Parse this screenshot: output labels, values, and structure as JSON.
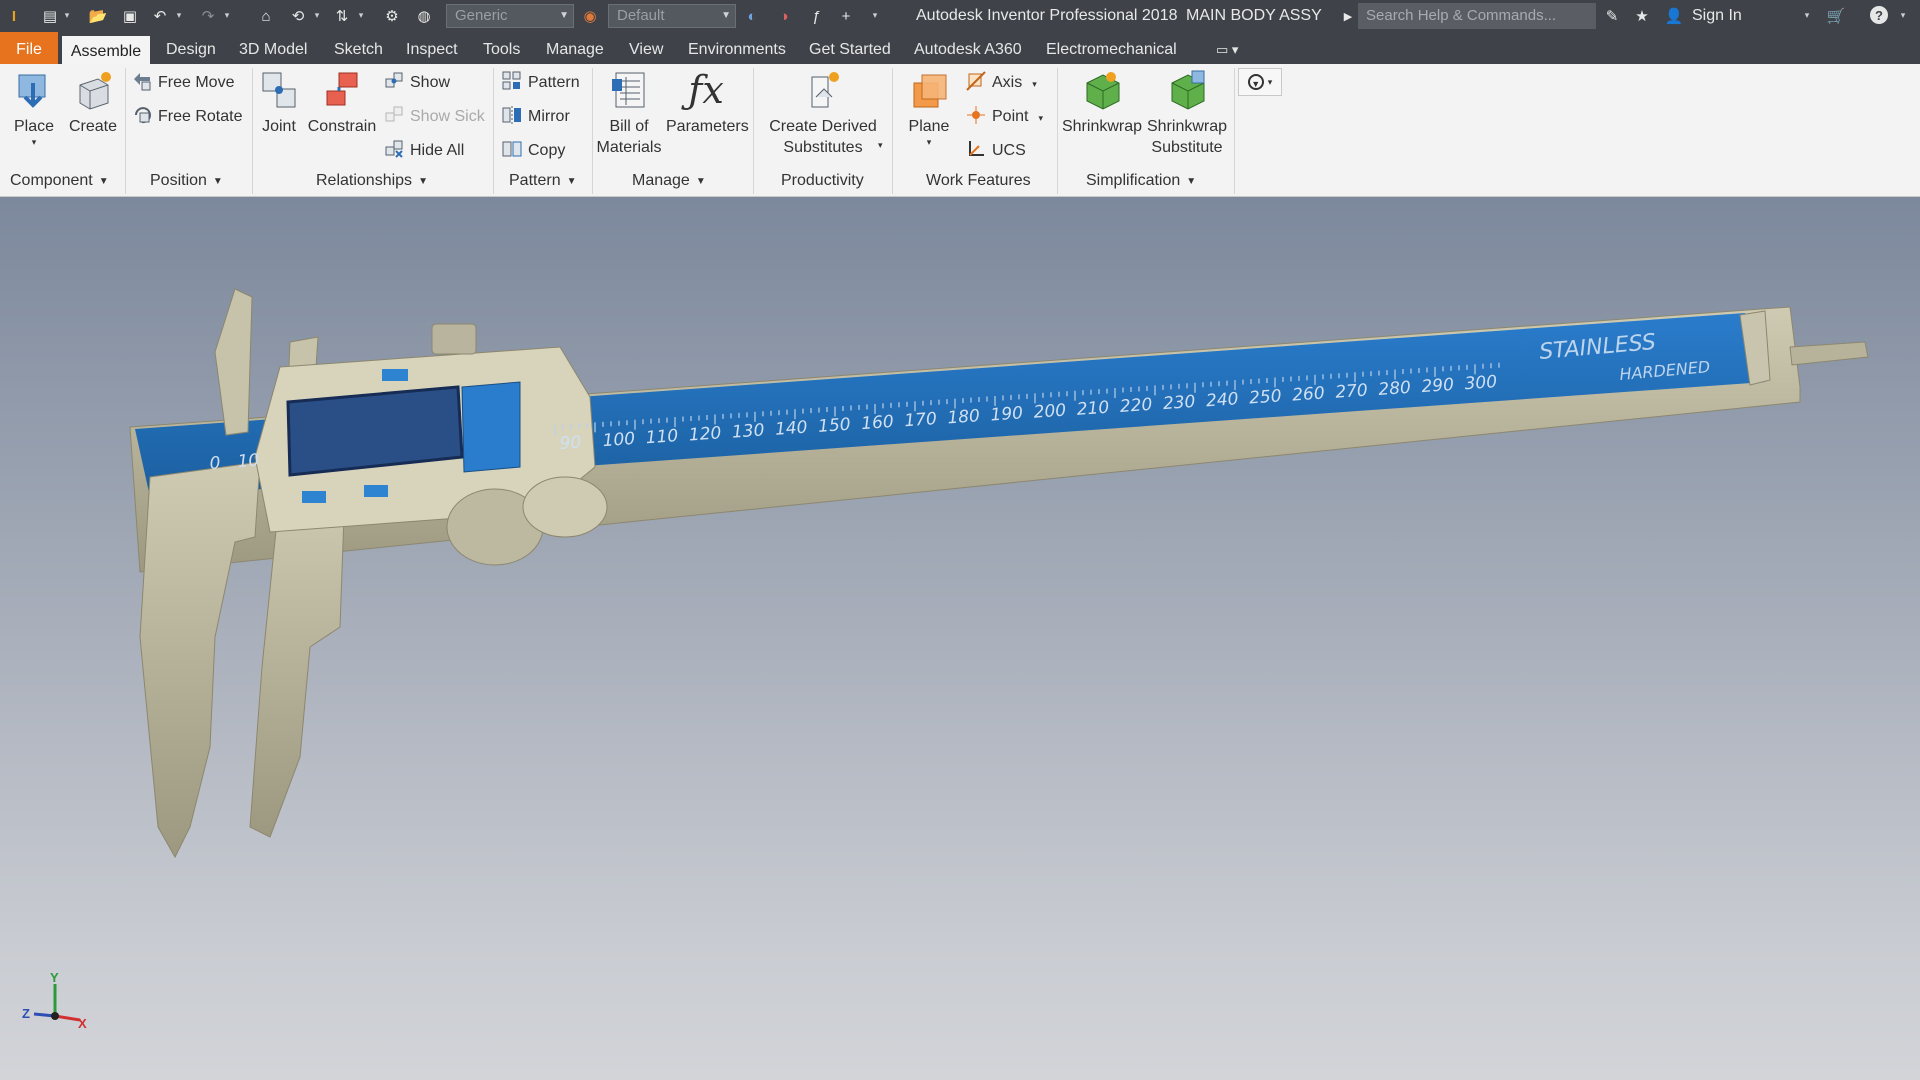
{
  "app": {
    "title": "Autodesk Inventor Professional 2018",
    "document": "MAIN BODY ASSY",
    "search_placeholder": "Search Help & Commands...",
    "sign_in": "Sign In",
    "appearance_style": "Generic",
    "visual_style": "Default"
  },
  "tabs": [
    "File",
    "Assemble",
    "Design",
    "3D Model",
    "Sketch",
    "Inspect",
    "Tools",
    "Manage",
    "View",
    "Environments",
    "Get Started",
    "Autodesk A360",
    "Electromechanical"
  ],
  "ribbon": {
    "component": {
      "label": "Component",
      "place": "Place",
      "create": "Create"
    },
    "position": {
      "label": "Position",
      "free_move": "Free Move",
      "free_rotate": "Free Rotate"
    },
    "relationships": {
      "label": "Relationships",
      "joint": "Joint",
      "constrain": "Constrain",
      "show": "Show",
      "show_sick": "Show Sick",
      "hide_all": "Hide All"
    },
    "pattern": {
      "label": "Pattern",
      "pattern": "Pattern",
      "mirror": "Mirror",
      "copy": "Copy"
    },
    "manage": {
      "label": "Manage",
      "bom_line1": "Bill of",
      "bom_line2": "Materials",
      "parameters": "Parameters"
    },
    "productivity": {
      "label": "Productivity",
      "cds_line1": "Create Derived",
      "cds_line2": "Substitutes"
    },
    "work_features": {
      "label": "Work Features",
      "plane": "Plane",
      "axis": "Axis",
      "point": "Point",
      "ucs": "UCS"
    },
    "simplification": {
      "label": "Simplification",
      "shrinkwrap": "Shrinkwrap",
      "sws_line1": "Shrinkwrap",
      "sws_line2": "Substitute"
    }
  },
  "model": {
    "scale_numbers": [
      "0",
      "10",
      "90",
      "100",
      "110",
      "120",
      "130",
      "140",
      "150",
      "160",
      "170",
      "180",
      "190",
      "200",
      "210",
      "220",
      "230",
      "240",
      "250",
      "260",
      "270",
      "280",
      "290",
      "300"
    ],
    "brand_line1": "STAINLESS",
    "brand_line2": "HARDENED"
  },
  "triad": {
    "x": "X",
    "y": "Y",
    "z": "Z"
  },
  "colors": {
    "accent": "#e8731f",
    "scale_blue": "#1f6fb8",
    "body_tan": "#b9b49d",
    "dark_bar": "#3f4349"
  }
}
